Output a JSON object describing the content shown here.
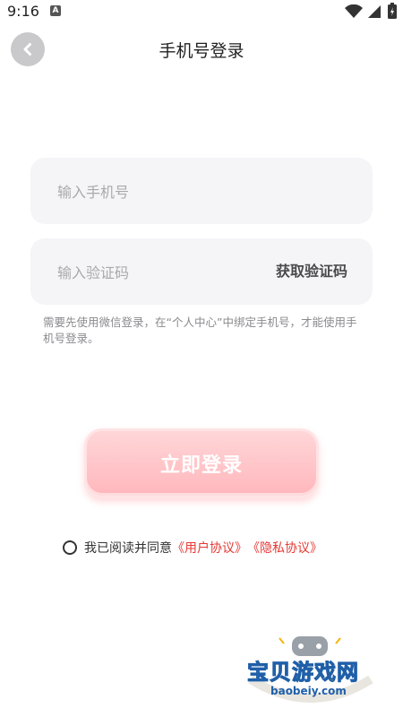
{
  "status_bar": {
    "time": "9:16",
    "app_icon": "A",
    "icons": [
      "wifi-icon",
      "signal-icon",
      "battery-charging-icon"
    ]
  },
  "header": {
    "title": "手机号登录",
    "back_icon": "chevron-left-icon"
  },
  "form": {
    "phone_placeholder": "输入手机号",
    "code_placeholder": "输入验证码",
    "get_code_label": "获取验证码",
    "hint": "需要先使用微信登录，在“个人中心”中绑定手机号，才能使用手机号登录。"
  },
  "login": {
    "label": "立即登录"
  },
  "agreement": {
    "prefix": "我已阅读并同意",
    "user_agreement": "《用户协议》",
    "privacy_agreement": "《隐私协议》",
    "checked": false
  },
  "watermark": {
    "title": "宝贝游戏网",
    "url": "baobeiy.com"
  },
  "colors": {
    "accent_red": "#e53935",
    "button_pink": "#ffb7bc",
    "input_bg": "#f5f5f8"
  }
}
